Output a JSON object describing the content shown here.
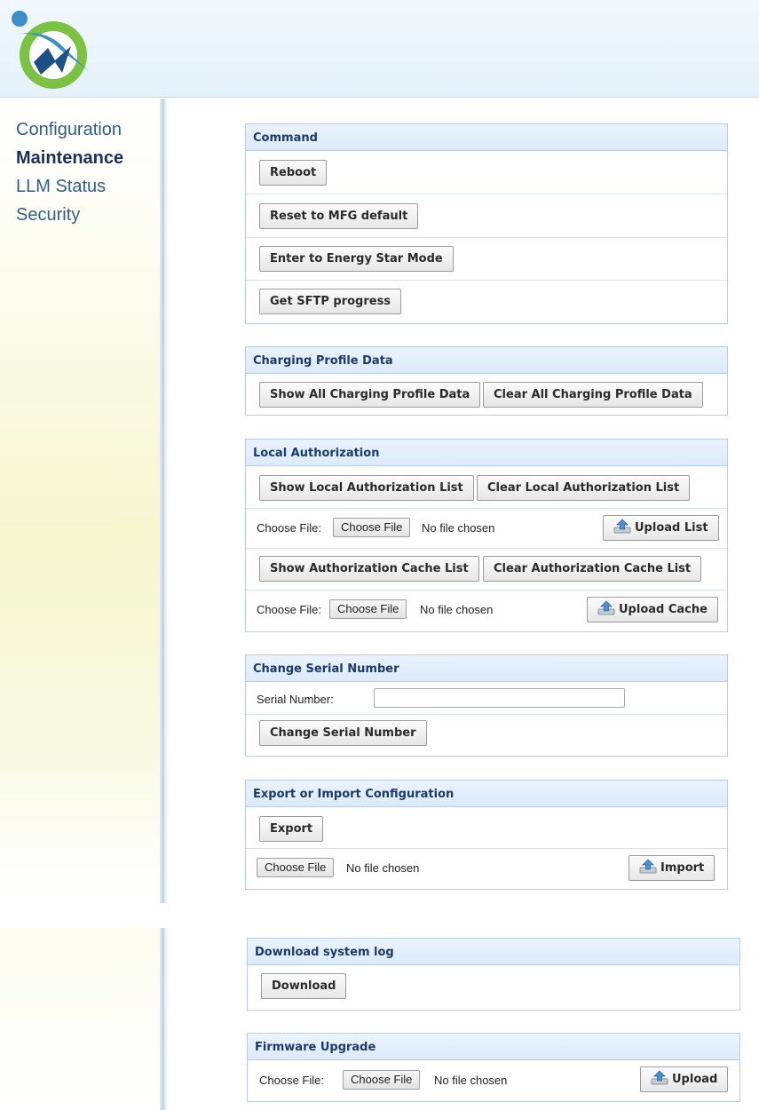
{
  "nav": {
    "items": [
      {
        "label": "Configuration",
        "active": false
      },
      {
        "label": "Maintenance",
        "active": true
      },
      {
        "label": "LLM Status",
        "active": false
      },
      {
        "label": "Security",
        "active": false
      }
    ]
  },
  "command": {
    "title": "Command",
    "reboot": "Reboot",
    "reset": "Reset to MFG default",
    "energy_star": "Enter to Energy Star Mode",
    "sftp": "Get SFTP progress"
  },
  "charging_profile": {
    "title": "Charging Profile Data",
    "show_all": "Show All Charging Profile Data",
    "clear_all": "Clear All Charging Profile Data"
  },
  "local_auth": {
    "title": "Local Authorization",
    "show_list": "Show Local Authorization List",
    "clear_list": "Clear Local Authorization List",
    "choose_file_label": "Choose File:",
    "choose_file_button": "Choose File",
    "no_file": "No file chosen",
    "upload_list": "Upload List",
    "show_cache": "Show Authorization Cache List",
    "clear_cache": "Clear Authorization Cache List",
    "upload_cache": "Upload Cache"
  },
  "serial": {
    "title": "Change Serial Number",
    "label": "Serial Number:",
    "value": "",
    "button": "Change Serial Number"
  },
  "export_import": {
    "title": "Export or Import Configuration",
    "export": "Export",
    "choose_file_button": "Choose File",
    "no_file": "No file chosen",
    "import": "Import"
  },
  "syslog": {
    "title": "Download system log",
    "download": "Download"
  },
  "firmware": {
    "title": "Firmware Upgrade",
    "choose_file_label": "Choose File:",
    "choose_file_button": "Choose File",
    "no_file": "No file chosen",
    "upload": "Upload"
  },
  "colors": {
    "nav_link": "#2f5d8c",
    "nav_active": "#1a2f5c",
    "panel_title": "#1d3a6c",
    "panel_border": "#b7cde3"
  },
  "icons": [
    "app-logo-icon",
    "upload-icon"
  ]
}
